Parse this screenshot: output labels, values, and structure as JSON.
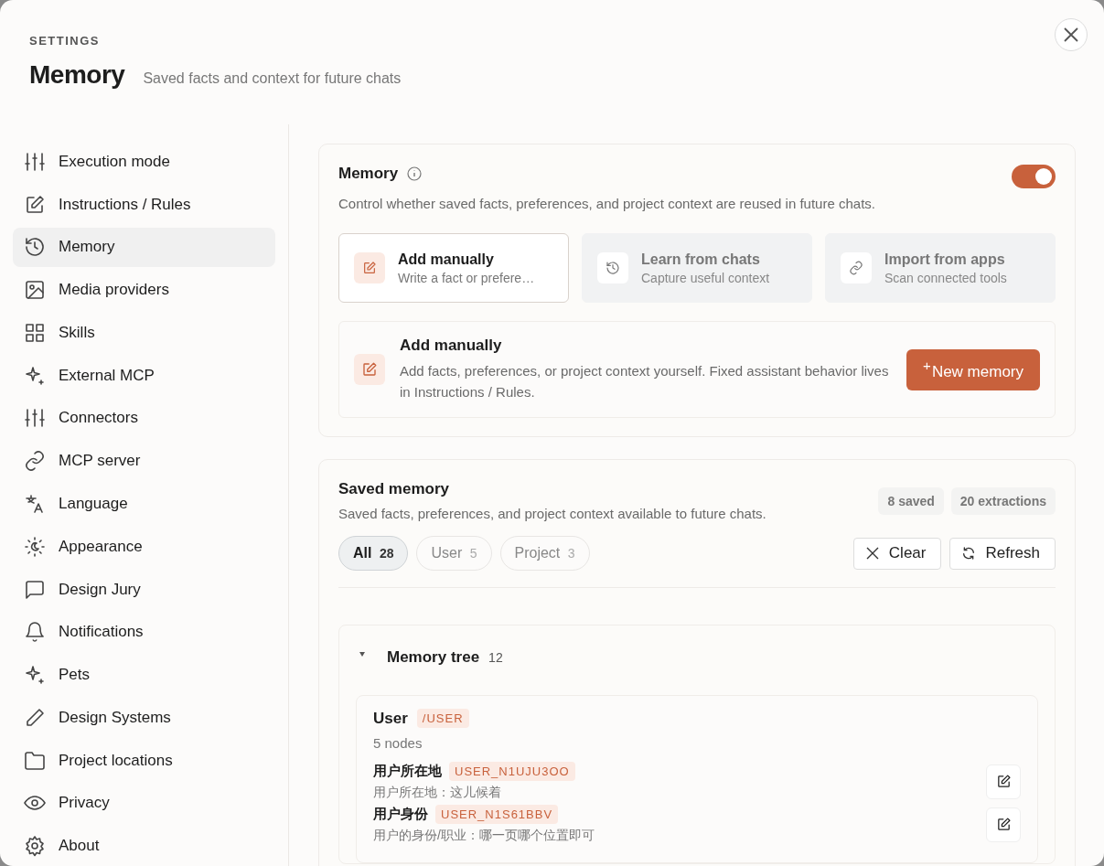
{
  "header": {
    "eyebrow": "SETTINGS",
    "title": "Memory",
    "subtitle": "Saved facts and context for future chats"
  },
  "sidebar": {
    "items": [
      {
        "label": "Execution mode",
        "selected": false
      },
      {
        "label": "Instructions / Rules",
        "selected": false
      },
      {
        "label": "Memory",
        "selected": true
      },
      {
        "label": "Media providers",
        "selected": false
      },
      {
        "label": "Skills",
        "selected": false
      },
      {
        "label": "External MCP",
        "selected": false
      },
      {
        "label": "Connectors",
        "selected": false
      },
      {
        "label": "MCP server",
        "selected": false
      },
      {
        "label": "Language",
        "selected": false
      },
      {
        "label": "Appearance",
        "selected": false
      },
      {
        "label": "Design Jury",
        "selected": false
      },
      {
        "label": "Notifications",
        "selected": false
      },
      {
        "label": "Pets",
        "selected": false
      },
      {
        "label": "Design Systems",
        "selected": false
      },
      {
        "label": "Project locations",
        "selected": false
      },
      {
        "label": "Privacy",
        "selected": false
      },
      {
        "label": "About",
        "selected": false
      }
    ]
  },
  "memory_card": {
    "title": "Memory",
    "description": "Control whether saved facts, preferences, and project context are reused in future chats.",
    "on": true,
    "sources": [
      {
        "title": "Add manually",
        "subtitle": "Write a fact or prefere…",
        "selected": true
      },
      {
        "title": "Learn from chats",
        "subtitle": "Capture useful context",
        "selected": false
      },
      {
        "title": "Import from apps",
        "subtitle": "Scan connected tools",
        "selected": false
      }
    ],
    "add_panel": {
      "title": "Add manually",
      "description": "Add facts, preferences, or project context yourself. Fixed assistant behavior lives in Instructions / Rules.",
      "button_icon": "+",
      "button": "New memory"
    }
  },
  "saved_memory": {
    "title": "Saved memory",
    "description": "Saved facts, preferences, and project context available to future chats.",
    "stats": [
      "8 saved",
      "20 extractions"
    ],
    "filters": [
      {
        "label": "All",
        "count": "28",
        "selected": true
      },
      {
        "label": "User",
        "count": "5",
        "selected": false
      },
      {
        "label": "Project",
        "count": "3",
        "selected": false
      }
    ],
    "actions": [
      "Clear",
      "Refresh"
    ],
    "tree": {
      "title": "Memory tree",
      "count": "12",
      "expanded": true,
      "children": [
        {
          "name": "User",
          "tag": "/USER",
          "summary": "5 nodes",
          "children": [
            {
              "title": "用户所在地",
              "tag": "USER_N1UJU3OO",
              "description": "用户所在地：这儿候着"
            },
            {
              "title": "用户身份",
              "tag": "USER_N1S61BBV",
              "description": "用户的身份/职业：哪一页哪个位置即可"
            }
          ]
        }
      ]
    }
  }
}
